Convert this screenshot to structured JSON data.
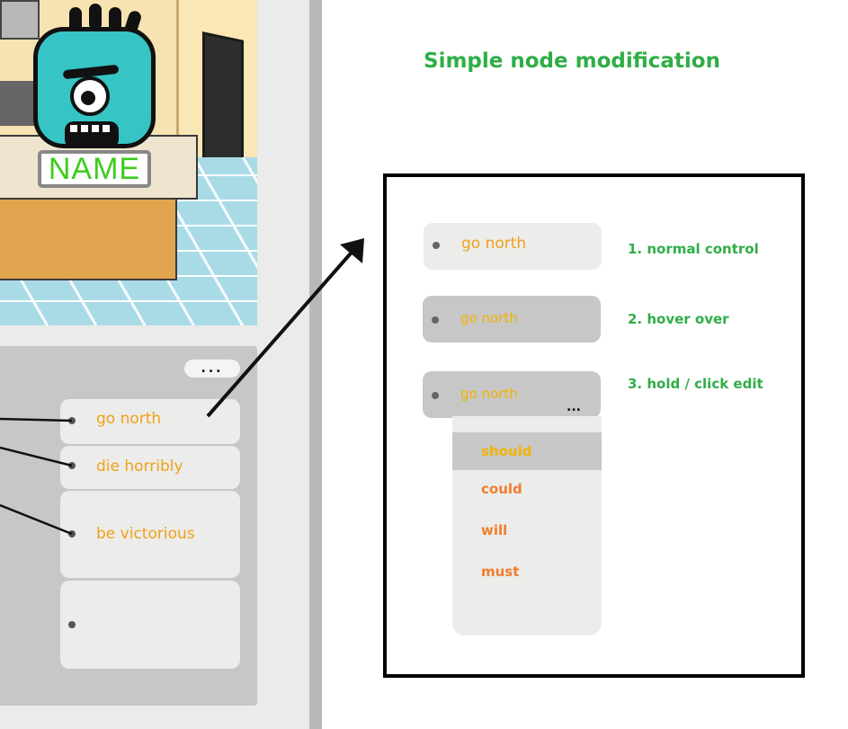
{
  "character": {
    "name_tag": "NAME"
  },
  "choices_panel": {
    "more_label": "...",
    "choices": [
      {
        "label": "go north"
      },
      {
        "label": "die horribly"
      },
      {
        "label": "be victorious"
      },
      {
        "label": ""
      }
    ]
  },
  "mockup": {
    "title": "Simple node modification",
    "states": [
      {
        "node_label": "go north",
        "step_label": "1. normal control"
      },
      {
        "node_label": "go north",
        "step_label": "2. hover over"
      },
      {
        "node_label": "go north",
        "step_label": "3. hold / click edit",
        "edit_icon": "..."
      }
    ],
    "dropdown_options": [
      "should",
      "could",
      "will",
      "must"
    ],
    "selected_option": "should"
  },
  "colors": {
    "title_green": "#2fae47",
    "choice_text": "#f0a11a",
    "option_text": "#f27d2c",
    "name_tag_green": "#3fcb1e"
  }
}
